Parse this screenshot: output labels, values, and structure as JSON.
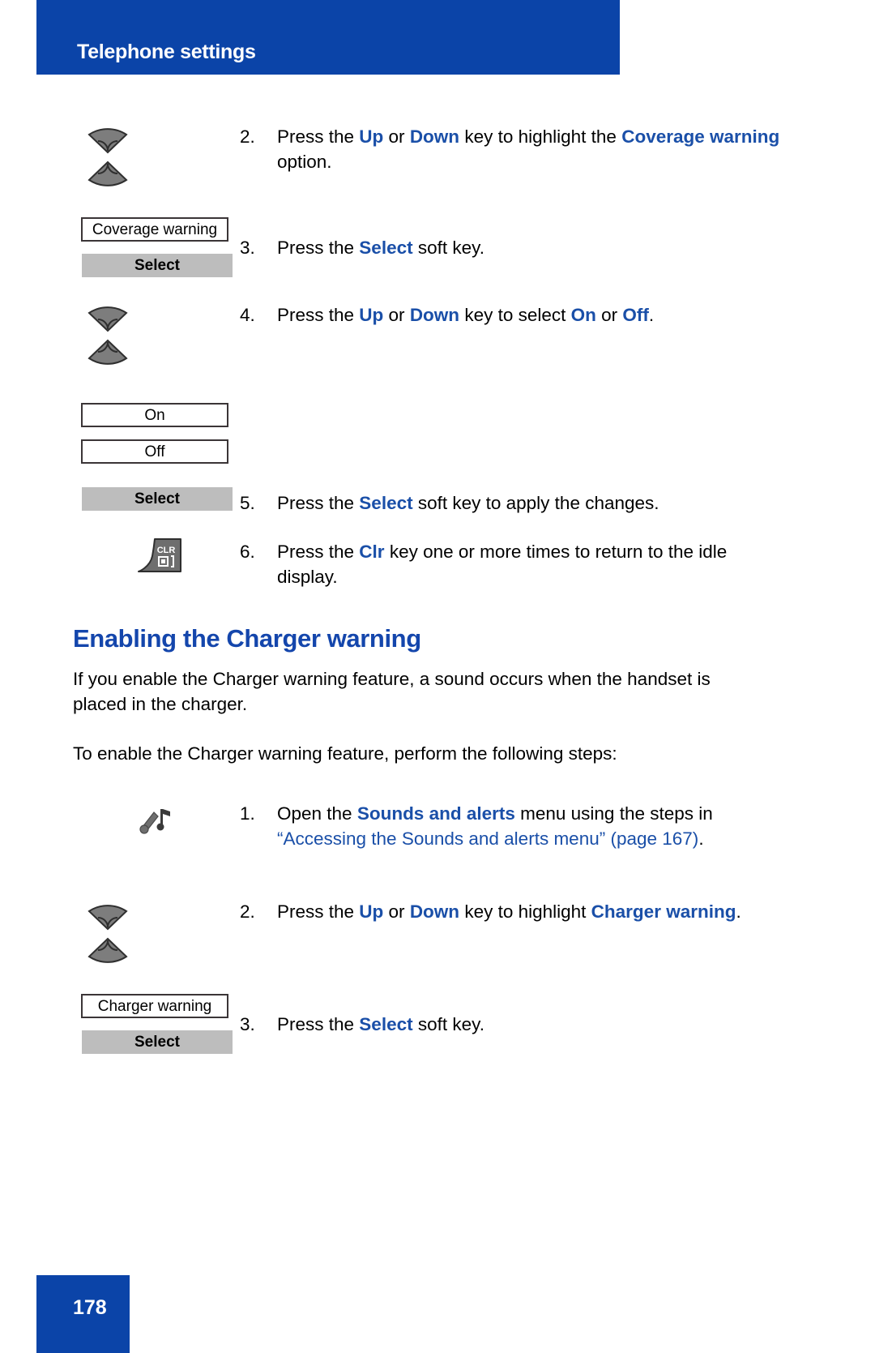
{
  "header": {
    "title": "Telephone settings",
    "banner_color": "#0b44a8"
  },
  "footer": {
    "page_number": "178",
    "banner_color": "#0b44a8"
  },
  "theme": {
    "accent_blue": "#1a4fa8",
    "heading_blue": "#1446ac",
    "softkey_gray": "#bdbdbd",
    "key_gray": "#6e6e6e"
  },
  "coverage_section": {
    "steps": [
      {
        "number": "2.",
        "icon": "up-down-nav-key-icon",
        "text_parts": [
          {
            "t": "Press the ",
            "style": "plain"
          },
          {
            "t": "Up",
            "style": "bold-blue"
          },
          {
            "t": " or ",
            "style": "plain"
          },
          {
            "t": "Down",
            "style": "bold-blue"
          },
          {
            "t": " key to highlight the ",
            "style": "plain"
          },
          {
            "t": "Coverage warning",
            "style": "bold-blue"
          },
          {
            "t": " option.",
            "style": "plain"
          }
        ]
      },
      {
        "number": "3.",
        "icon": "display-and-softkey",
        "text_parts": [
          {
            "t": "Press the ",
            "style": "plain"
          },
          {
            "t": "Select",
            "style": "bold-blue"
          },
          {
            "t": " soft key.",
            "style": "plain"
          }
        ]
      },
      {
        "number": "4.",
        "icon": "up-down-nav-key-icon",
        "text_parts": [
          {
            "t": "Press the ",
            "style": "plain"
          },
          {
            "t": "Up",
            "style": "bold-blue"
          },
          {
            "t": " or ",
            "style": "plain"
          },
          {
            "t": "Down",
            "style": "bold-blue"
          },
          {
            "t": " key to select ",
            "style": "plain"
          },
          {
            "t": "On",
            "style": "bold-blue"
          },
          {
            "t": " or ",
            "style": "plain"
          },
          {
            "t": "Off",
            "style": "bold-blue"
          },
          {
            "t": ".",
            "style": "plain"
          }
        ]
      },
      {
        "number": "5.",
        "icon": "select-softkey",
        "text_parts": [
          {
            "t": "Press the ",
            "style": "plain"
          },
          {
            "t": "Select",
            "style": "bold-blue"
          },
          {
            "t": " soft key to apply the changes.",
            "style": "plain"
          }
        ]
      },
      {
        "number": "6.",
        "icon": "clr-key-icon",
        "text_parts": [
          {
            "t": "Press the ",
            "style": "plain"
          },
          {
            "t": "Clr",
            "style": "bold-blue"
          },
          {
            "t": " key one or more times to return to the idle display.",
            "style": "plain"
          }
        ]
      }
    ],
    "display_coverage_warning": "Coverage warning",
    "softkey_select_1": "Select",
    "display_on": "On",
    "display_off": "Off",
    "softkey_select_2": "Select"
  },
  "charger_section": {
    "heading": "Enabling the Charger warning",
    "paragraph_1": "If you enable the Charger warning feature, a sound occurs when the handset is placed in the charger.",
    "paragraph_2": "To enable the Charger warning feature, perform the following steps:",
    "steps": [
      {
        "number": "1.",
        "icon": "sounds-and-alerts-icon",
        "text_parts": [
          {
            "t": "Open the ",
            "style": "plain"
          },
          {
            "t": "Sounds and alerts",
            "style": "bold-blue"
          },
          {
            "t": " menu using the steps in ",
            "style": "plain"
          },
          {
            "t": "“Accessing the Sounds and alerts menu” (page 167)",
            "style": "link"
          },
          {
            "t": ".",
            "style": "plain"
          }
        ]
      },
      {
        "number": "2.",
        "icon": "up-down-nav-key-icon",
        "text_parts": [
          {
            "t": "Press the ",
            "style": "plain"
          },
          {
            "t": "Up",
            "style": "bold-blue"
          },
          {
            "t": " or ",
            "style": "plain"
          },
          {
            "t": "Down",
            "style": "bold-blue"
          },
          {
            "t": " key to highlight ",
            "style": "plain"
          },
          {
            "t": "Charger warning",
            "style": "bold-blue"
          },
          {
            "t": ".",
            "style": "plain"
          }
        ]
      },
      {
        "number": "3.",
        "icon": "display-and-softkey",
        "text_parts": [
          {
            "t": "Press the ",
            "style": "plain"
          },
          {
            "t": "Select",
            "style": "bold-blue"
          },
          {
            "t": " soft key.",
            "style": "plain"
          }
        ]
      }
    ],
    "display_charger_warning": "Charger warning",
    "softkey_select": "Select"
  },
  "icons": {
    "nav_key": "up-down-nav-key-icon",
    "clr_key_label": "CLR",
    "sounds_alerts": "sounds-and-alerts-icon"
  }
}
